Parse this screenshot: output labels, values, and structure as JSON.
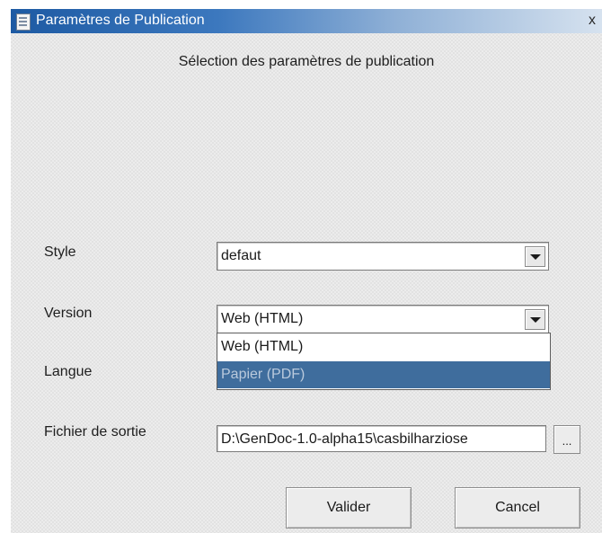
{
  "window": {
    "title": "Paramètres de Publication",
    "close_label": "x"
  },
  "heading": "Sélection des paramètres de publication",
  "fields": {
    "style": {
      "label": "Style",
      "value": "defaut"
    },
    "version": {
      "label": "Version",
      "value": "Web (HTML)",
      "options": [
        "Web (HTML)",
        "Papier (PDF)"
      ],
      "highlighted_option": "Papier (PDF)"
    },
    "langue": {
      "label": "Langue"
    },
    "output": {
      "label": "Fichier de sortie",
      "value": "D:\\GenDoc-1.0-alpha15\\casbilharziose",
      "browse_label": "..."
    }
  },
  "buttons": {
    "validate": "Valider",
    "cancel": "Cancel"
  },
  "colors": {
    "titlebar_start": "#1d5aa3",
    "selection_bg": "#3f6d9d",
    "selection_text": "#b9c9dc"
  },
  "icons": {
    "window": "document-icon",
    "dropdown": "chevron-down-icon"
  }
}
